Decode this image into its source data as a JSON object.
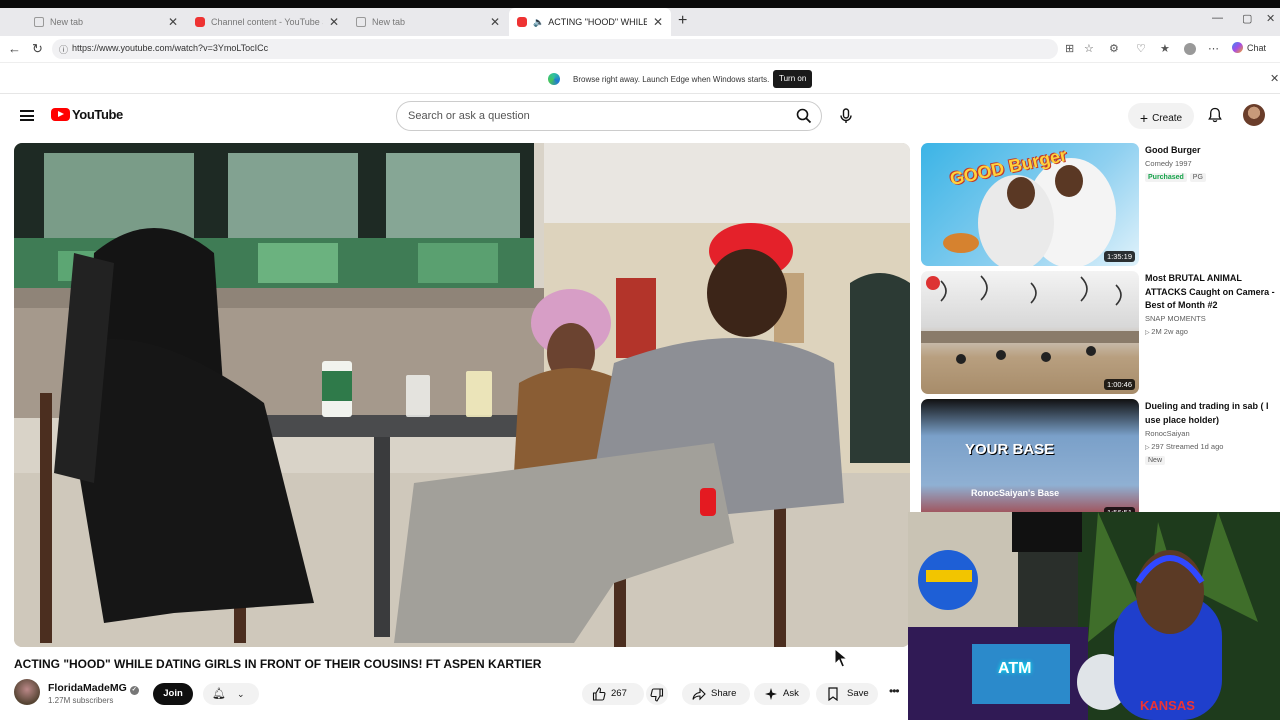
{
  "browser": {
    "tabs": [
      {
        "title": "New tab",
        "active": false
      },
      {
        "title": "Channel content - YouTube Studio",
        "active": false
      },
      {
        "title": "New tab",
        "active": false
      },
      {
        "title": "ACTING \"HOOD\" WHILE DATI",
        "active": true
      }
    ],
    "url": "https://www.youtube.com/watch?v=3YmoLTocICc",
    "chat_label": "Chat",
    "banner": {
      "message": "Browse right away. Launch Edge when Windows starts.",
      "button": "Turn on"
    }
  },
  "youtube": {
    "logo_text": "YouTube",
    "search_placeholder": "Search or ask a question",
    "create_label": "Create"
  },
  "video": {
    "title": "ACTING \"HOOD\" WHILE DATING GIRLS IN FRONT OF THEIR COUSINS! FT ASPEN KARTIER",
    "channel": "FloridaMadeMG",
    "subscribers": "1.27M subscribers",
    "join_label": "Join",
    "likes": "267",
    "share_label": "Share",
    "ask_label": "Ask",
    "save_label": "Save"
  },
  "sidebar": [
    {
      "title": "Good Burger",
      "meta": "Comedy 1997",
      "badges": [
        "Purchased",
        "PG"
      ],
      "duration": "1:35:19",
      "thumb_text": "GOOD Burger"
    },
    {
      "title": "Most BRUTAL ANIMAL ATTACKS Caught on Camera - Best of Month #2",
      "channel": "SNAP MOMENTS",
      "stats": "2M  2w ago",
      "duration": "1:00:46"
    },
    {
      "title": "Dueling and trading in sab ( I use place holder)",
      "channel": "RonocSaiyan",
      "stats": "297  Streamed 1d ago",
      "badge": "New",
      "duration": "1:56:51",
      "thumb_text_1": "YOUR BASE",
      "thumb_text_2": "RonocSaiyan's Base"
    }
  ],
  "webcam": {
    "shirt_text": "KANSAS",
    "sign_text": "ATM"
  }
}
